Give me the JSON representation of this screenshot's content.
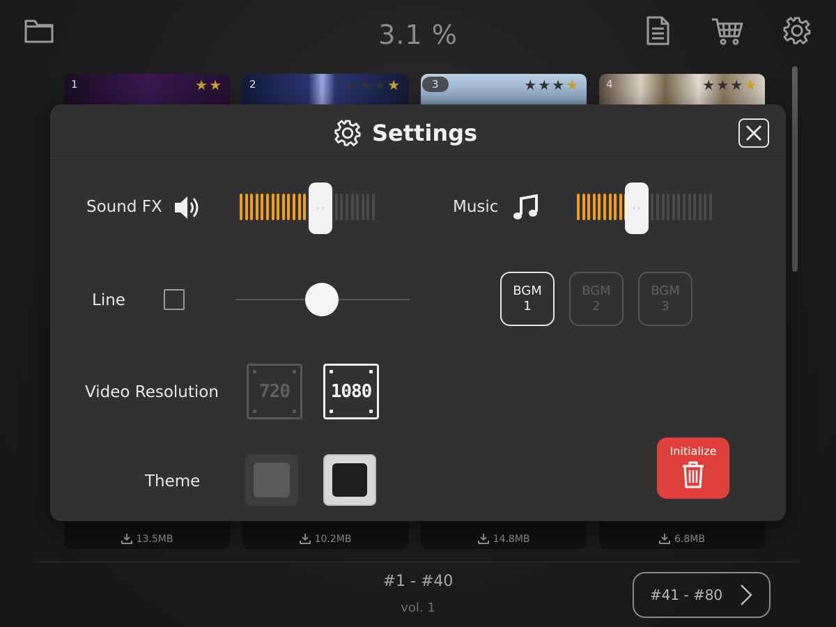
{
  "topbar": {
    "progress_text": "3.1 %",
    "folder_icon": "folder-icon",
    "document_icon": "document-icon",
    "cart_icon": "cart-icon",
    "gear_icon": "gear-icon"
  },
  "cards": [
    {
      "number": "1",
      "stars_on": 2,
      "stars_total": 2,
      "size": "13.5MB"
    },
    {
      "number": "2",
      "stars_on": 1,
      "stars_total": 4,
      "size": "10.2MB"
    },
    {
      "number": "3",
      "stars_on": 1,
      "stars_total": 4,
      "size": "14.8MB"
    },
    {
      "number": "4",
      "stars_on": 1,
      "stars_total": 4,
      "size": "6.8MB"
    }
  ],
  "footer": {
    "range": "#1 - #40",
    "volume": "vol. 1",
    "next_range": "#41 - #80"
  },
  "settings": {
    "title": "Settings",
    "sound_fx_label": "Sound FX",
    "sound_fx_level": 0.6,
    "music_label": "Music",
    "music_level": 0.42,
    "line_label": "Line",
    "line_checked": false,
    "line_slider_value": 0.5,
    "bgm": [
      {
        "line1": "BGM",
        "line2": "1",
        "selected": true
      },
      {
        "line1": "BGM",
        "line2": "2",
        "selected": false
      },
      {
        "line1": "BGM",
        "line2": "3",
        "selected": false
      }
    ],
    "video_resolution_label": "Video Resolution",
    "resolutions": [
      {
        "label": "720",
        "selected": false
      },
      {
        "label": "1080",
        "selected": true
      }
    ],
    "theme_label": "Theme",
    "initialize_label": "Initialize"
  },
  "colors": {
    "accent": "#f0a020",
    "initialize": "#e0403c",
    "star": "#c9a227"
  }
}
